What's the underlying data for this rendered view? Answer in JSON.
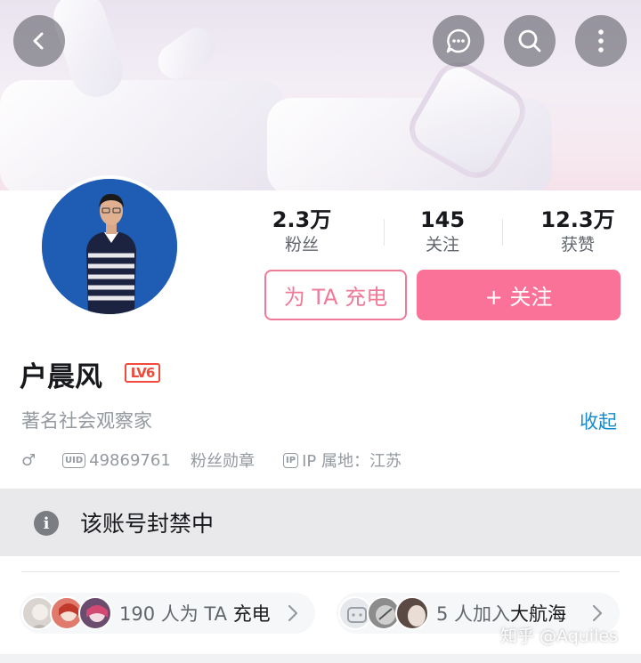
{
  "header": {
    "back_icon": "chevron-left-icon",
    "actions": [
      "message-icon",
      "search-icon",
      "more-vertical-icon"
    ]
  },
  "profile": {
    "stats": [
      {
        "value": "2.3万",
        "label": "粉丝"
      },
      {
        "value": "145",
        "label": "关注"
      },
      {
        "value": "12.3万",
        "label": "获赞"
      }
    ],
    "charge_button": "为 TA 充电",
    "follow_button": "+ 关注",
    "name": "户晨风",
    "level": "LV6",
    "signature": "著名社会观察家",
    "collapse_link": "收起",
    "uid_badge": "UID",
    "uid": "49869761",
    "medal": "粉丝勋章",
    "ip_badge": "IP",
    "ip_location": "IP 属地：江苏",
    "gender_symbol": "♂"
  },
  "notice": {
    "icon": "info-icon",
    "text": "该账号封禁中"
  },
  "supporters": {
    "charge_count": "190 人为 TA",
    "charge_action": "充电",
    "voyage_count": "5 人加入",
    "voyage_action": "大航海"
  },
  "watermark": "知乎 @Aquiles",
  "colors": {
    "accent_pink": "#fb7299",
    "link_blue": "#178bcf",
    "level_red": "#f14a3c"
  }
}
